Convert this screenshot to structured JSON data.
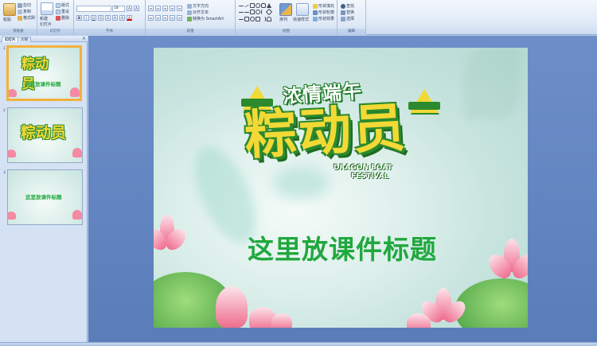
{
  "ribbon": {
    "clipboard": {
      "paste": "粘贴",
      "cut": "剪切",
      "copy": "复制",
      "format_painter": "格式刷",
      "label": "剪贴板"
    },
    "slides": {
      "new_slide": "新建",
      "new_slide_sub": "幻灯片",
      "layout": "版式",
      "reset": "重设",
      "delete": "删除",
      "label": "幻灯片"
    },
    "font": {
      "size": "18",
      "label": "字体"
    },
    "paragraph": {
      "text_direction": "文字方向",
      "align_text": "对齐文本",
      "smartart": "转换为 SmartArt",
      "label": "段落"
    },
    "drawing": {
      "arrange": "排列",
      "quick_styles": "快速样式",
      "shape_fill": "形状填充",
      "shape_outline": "形状轮廓",
      "shape_effects": "形状效果",
      "label": "绘图"
    },
    "editing": {
      "find": "查找",
      "replace": "替换",
      "select": "选择",
      "label": "编辑"
    }
  },
  "panel": {
    "tabs": [
      "幻灯片",
      "大纲"
    ],
    "slide_numbers": [
      "1",
      "2",
      "3"
    ],
    "thumb_title": "这里放课件标题"
  },
  "slide": {
    "top_text": "浓情端午",
    "main_text": "粽动员",
    "en_line1": "DRAGON BOAT",
    "en_line2": "FESTIVAL",
    "course_title": "这里放课件标题"
  },
  "colors": {
    "title_green": "#20a83e",
    "logo_yellow": "#f3d936",
    "logo_green": "#2b8a2e",
    "thumb_selected": "#f3b13b"
  }
}
